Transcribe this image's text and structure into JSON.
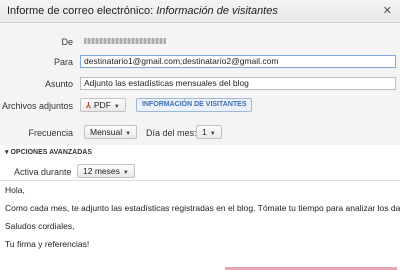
{
  "window": {
    "title_main": "Informe de correo electrónico: ",
    "title_sub": "Información de visitantes",
    "close_glyph": "✕"
  },
  "fields": {
    "from_label": "De",
    "to_label": "Para",
    "to_value": "destinatario1@gmail.com;destinatario2@gmail.com",
    "subject_label": "Asunto",
    "subject_value": "Adjunto las estadísticas mensuales del blog",
    "attachments_label": "Archivos adjuntos",
    "attachment_format": "PDF",
    "attachment_icon": "pdf-icon",
    "attachment_chip": "INFORMACIÓN DE VISITANTES",
    "frequency_label": "Frecuencia",
    "frequency_value": "Mensual",
    "day_label": "Día del mes:",
    "day_value": "1"
  },
  "advanced": {
    "toggle_glyph": "▾",
    "label": "OPCIONES AVANZADAS",
    "active_label": "Activa durante",
    "active_value": "12 meses"
  },
  "message": {
    "lines": [
      "Hola,",
      "Como cada mes, te adjunto las estadísticas registradas en el blog. Tómate tu tiempo para analizar los datos.",
      "Saludos cordiales,",
      "Tu firma y referencias!"
    ]
  },
  "colors": {
    "accent_blue": "#3b6fb3",
    "pdf_red": "#c0392b",
    "bottom_accent": "#e9a6b2"
  }
}
